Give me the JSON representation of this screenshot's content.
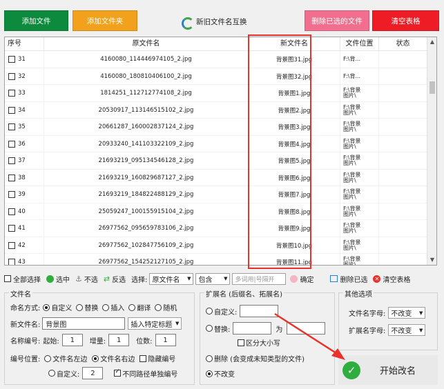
{
  "toolbar": {
    "add_file": "添加文件",
    "add_folder": "添加文件夹",
    "swap": "新旧文件名互换",
    "delete_selected": "删除已选的文件",
    "clear_table": "清空表格"
  },
  "colors": {
    "green": "#0d8a3d",
    "orange": "#f2a11d",
    "pink": "#f16e8e",
    "red": "#ee1c25",
    "highlight": "#e8322b"
  },
  "table": {
    "headers": [
      "序号",
      "原文件名",
      "新文件名",
      "文件位置",
      "状态"
    ],
    "rows": [
      {
        "no": "31",
        "old": "4160080_114446974105_2.jpg",
        "new": "背景图31.jpg",
        "loc": "F:\\背..."
      },
      {
        "no": "32",
        "old": "4160080_180810406100_2.jpg",
        "new": "背景图32.jpg",
        "loc": "F:\\背..."
      },
      {
        "no": "33",
        "old": "1814251_112712774108_2.jpg",
        "new": "背景图1.jpg",
        "loc": "F:\\背景\n图片\\"
      },
      {
        "no": "34",
        "old": "20530917_113146515102_2.jpg",
        "new": "背景图2.jpg",
        "loc": "F:\\背景\n图片\\"
      },
      {
        "no": "35",
        "old": "20661287_160002837124_2.jpg",
        "new": "背景图3.jpg",
        "loc": "F:\\背景\n图片\\"
      },
      {
        "no": "36",
        "old": "20933240_141103322109_2.jpg",
        "new": "背景图4.jpg",
        "loc": "F:\\背景\n图片\\"
      },
      {
        "no": "37",
        "old": "21693219_095134546128_2.jpg",
        "new": "背景图5.jpg",
        "loc": "F:\\背景\n图片\\"
      },
      {
        "no": "38",
        "old": "21693219_160829687127_2.jpg",
        "new": "背景图6.jpg",
        "loc": "F:\\背景\n图片\\"
      },
      {
        "no": "39",
        "old": "21693219_184822488129_2.jpg",
        "new": "背景图7.jpg",
        "loc": "F:\\背景\n图片\\"
      },
      {
        "no": "40",
        "old": "25059247_100155915104_2.jpg",
        "new": "背景图8.jpg",
        "loc": "F:\\背景\n图片\\"
      },
      {
        "no": "41",
        "old": "26977562_095659783106_2.jpg",
        "new": "背景图9.jpg",
        "loc": "F:\\背景\n图片\\"
      },
      {
        "no": "42",
        "old": "26977562_102847756109_2.jpg",
        "new": "背景图10.jpg",
        "loc": "F:\\背景\n图片\\"
      },
      {
        "no": "43",
        "old": "26977562_154252127105_2.jpg",
        "new": "背景图11.jpg",
        "loc": "F:\\背景\n图片\\"
      }
    ]
  },
  "actions": {
    "select_all": "全部选择",
    "select": "选中",
    "unselect": "不选",
    "invert": "反选",
    "choose_label": "选择:",
    "field_value": "原文件名",
    "mode_value": "包含",
    "keyword_placeholder": "多词用|号隔开",
    "confirm": "确定",
    "delete_selected": "删除已选",
    "clear_table": "清空表格"
  },
  "filename": {
    "title": "文件名",
    "mode_label": "命名方式:",
    "modes": [
      "自定义",
      "替换",
      "插入",
      "翻译",
      "随机"
    ],
    "new_name_label": "新文件名:",
    "new_name_value": "背景图",
    "insert_title": "插入特定标题",
    "numbering_label": "名称编号:",
    "start_label": "起始:",
    "start_value": "1",
    "step_label": "增量:",
    "step_value": "1",
    "digits_label": "位数:",
    "digits_value": "1",
    "position_label": "编号位置:",
    "left_label": "文件名左边",
    "right_label": "文件名右边",
    "hide_number": "隐藏编号",
    "custom_label": "自定义:",
    "custom_value": "2",
    "path_separate": "不同路径单独编号"
  },
  "extension": {
    "title": "扩展名 (后缀名、拓展名)",
    "custom_label": "自定义:",
    "replace_label": "替换:",
    "to_label": "为",
    "case_label": "区分大小写",
    "delete_label": "删除 (会变成未知类型的文件)",
    "unchanged_label": "不改变"
  },
  "other": {
    "title": "其他选项",
    "filename_case_label": "文件名字母:",
    "filename_case_value": "不改变",
    "ext_case_label": "扩展名字母:",
    "ext_case_value": "不改变"
  },
  "start_button": "开始改名"
}
